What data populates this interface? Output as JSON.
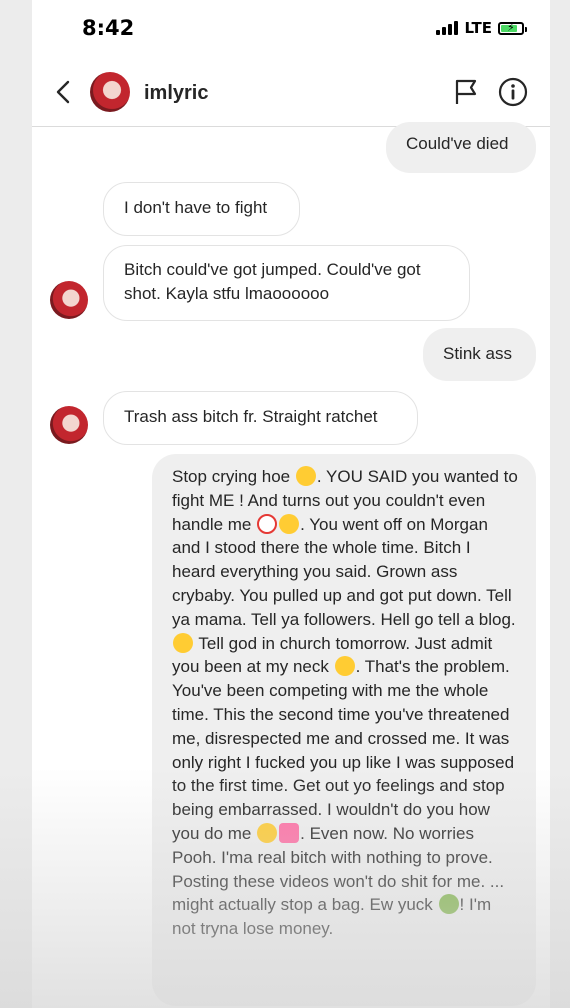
{
  "status_bar": {
    "time": "8:42",
    "network": "LTE"
  },
  "header": {
    "username": "imlyric"
  },
  "messages": [
    {
      "side": "outgoing",
      "text": "Could've died"
    },
    {
      "side": "incoming",
      "text": "I don't have to fight"
    },
    {
      "side": "incoming",
      "text": "Bitch could've got jumped. Could've got shot. Kayla stfu lmaoooooo"
    },
    {
      "side": "outgoing",
      "text": "Stink ass"
    },
    {
      "side": "incoming",
      "text": "Trash ass bitch fr. Straight ratchet"
    },
    {
      "side": "outgoing",
      "parts": [
        "Stop crying hoe",
        ". YOU SAID you wanted to fight ME ! And turns out you couldn't even handle me",
        ". You went off on Morgan and I stood there the whole time. Bitch I heard everything you said. Grown ass crybaby. You pulled up and got put down. Tell ya mama. Tell ya followers. Hell go tell a blog.",
        "Tell god in church tomorrow. Just admit you been at my neck",
        ". That's the problem. You've been competing with me the whole time. This the second time you've threatened me, disrespected me and crossed me. It was only right I fucked you up like I was supposed to the first time. Get out yo feelings and stop being embarrassed. I wouldn't do you how you do me",
        ". Even now. No worries Pooh. I'ma real bitch with nothing to prove. Posting these videos won't do shit for me. ... might actually stop a bag. Ew yuck",
        "! I'm not tryna lose money."
      ]
    }
  ],
  "icons": [
    "back-chevron-icon",
    "flag-icon",
    "info-icon",
    "signal-icon",
    "battery-charging-icon"
  ]
}
